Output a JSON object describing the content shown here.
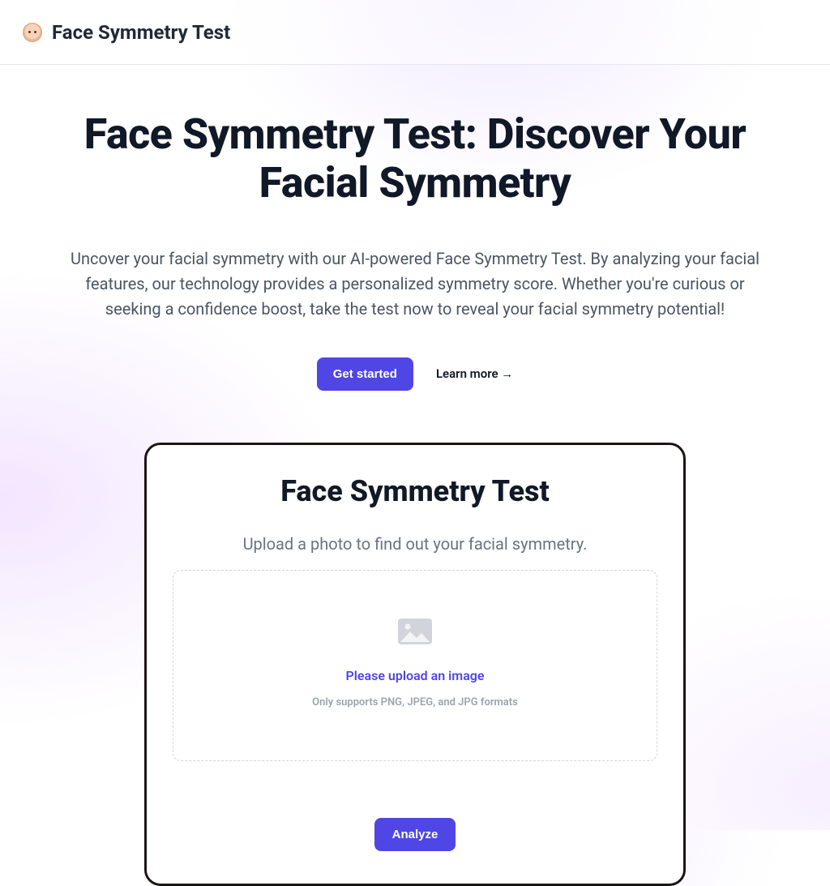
{
  "header": {
    "brand": "Face Symmetry Test"
  },
  "hero": {
    "title": "Face Symmetry Test: Discover Your Facial Symmetry",
    "description": "Uncover your facial symmetry with our AI-powered Face Symmetry Test. By analyzing your facial features, our technology provides a personalized symmetry score. Whether you're curious or seeking a confidence boost, take the test now to reveal your facial symmetry potential!",
    "cta_primary": "Get started",
    "cta_secondary": "Learn more →"
  },
  "card": {
    "title": "Face Symmetry Test",
    "subtitle": "Upload a photo to find out your facial symmetry.",
    "upload_prompt": "Please upload an image",
    "upload_hint": "Only supports PNG, JPEG, and JPG formats",
    "analyze_label": "Analyze"
  },
  "colors": {
    "accent": "#4f46e5"
  }
}
